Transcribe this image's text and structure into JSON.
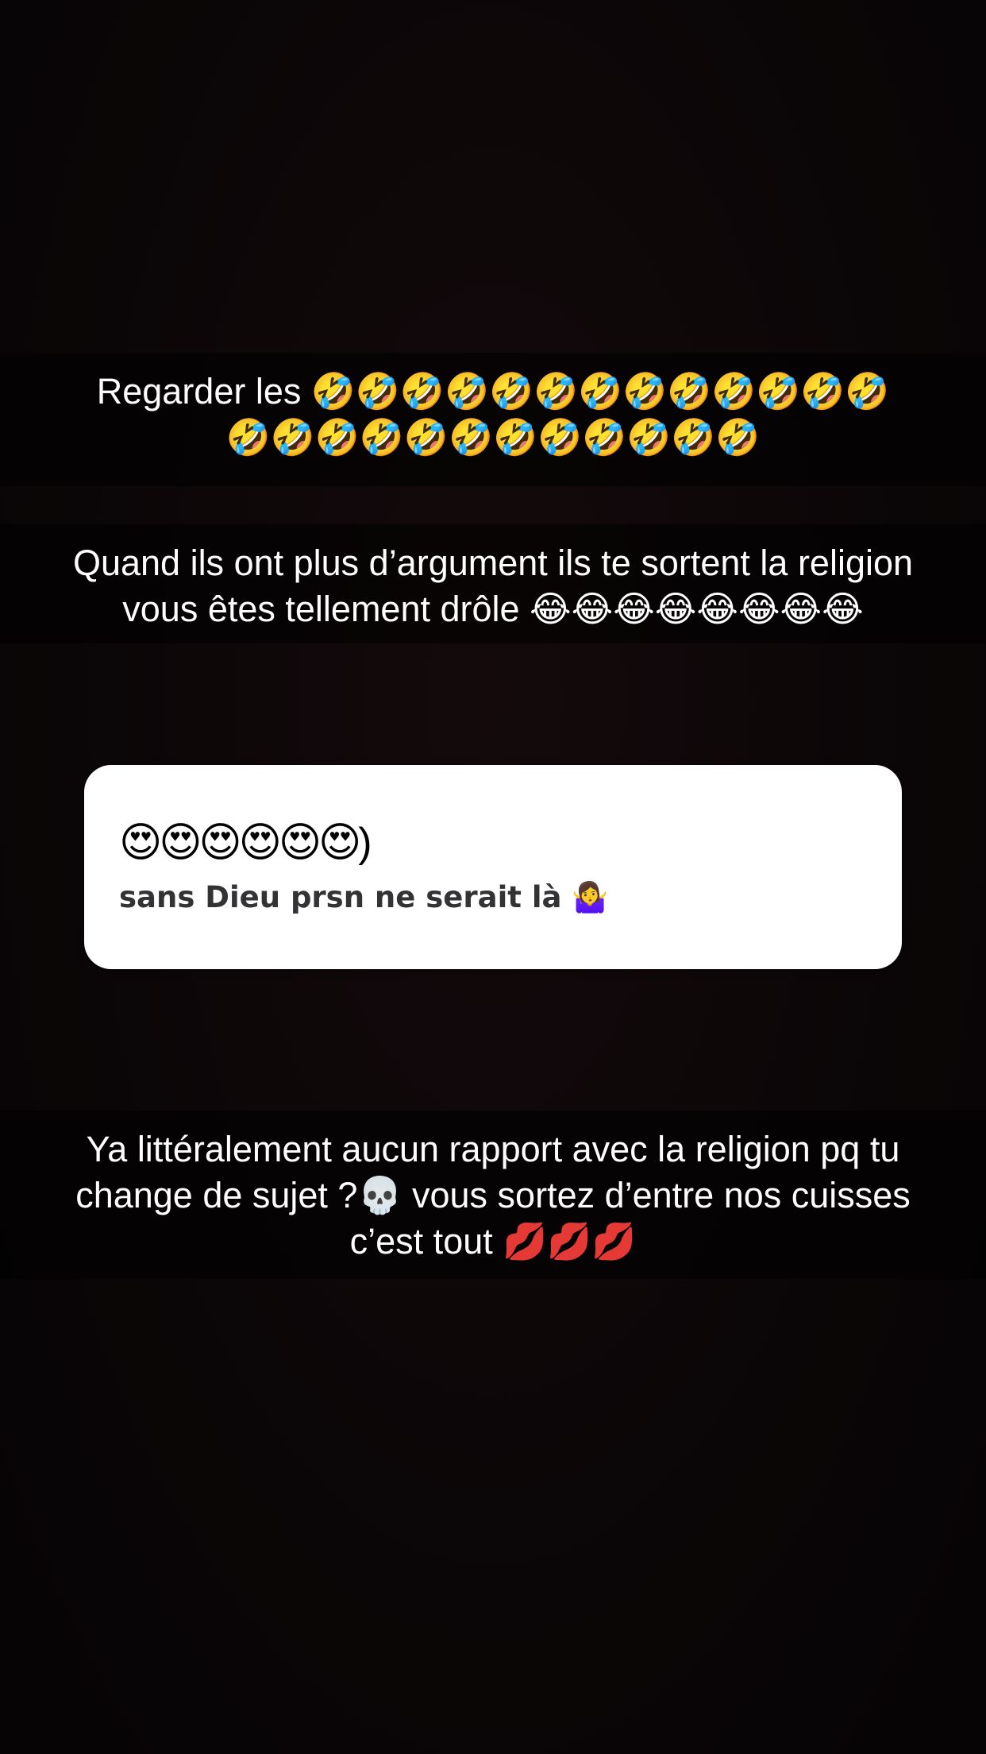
{
  "captions": {
    "first": "Regarder les 🤣🤣🤣🤣🤣🤣🤣🤣🤣🤣🤣🤣🤣\n🤣🤣🤣🤣🤣🤣🤣🤣🤣🤣🤣🤣",
    "second": "Quand ils ont plus d’argument ils te sortent la religion vous êtes tellement drôle 😂😂😂😂😂😂😂😂",
    "third": "Ya littéralement aucun rapport avec la religion pq tu change de sujet ?💀 vous sortez d’entre nos cuisses c’est tout 💋💋💋"
  },
  "sticker": {
    "emoji_row": "😍😍😍😍😍😍)",
    "text": "sans Dieu prsn ne serait là 🤷‍♀️"
  },
  "colors": {
    "background": "#0b0607",
    "caption_bg": "rgba(0,0,0,0.55)",
    "caption_text": "#ffffff",
    "sticker_bg": "#ffffff",
    "sticker_text": "#333336"
  }
}
